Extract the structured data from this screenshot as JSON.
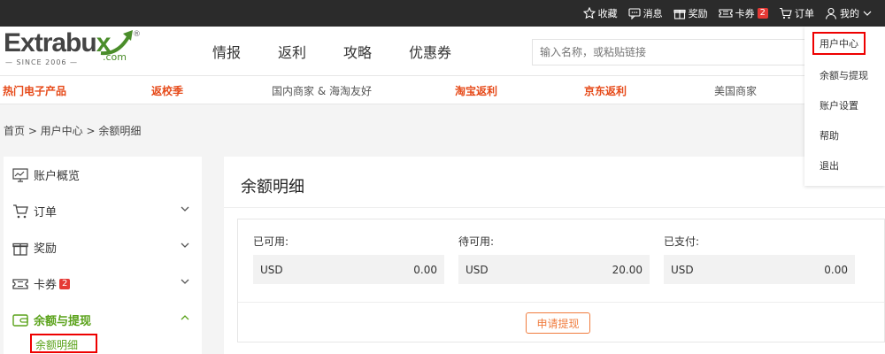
{
  "topbar": {
    "links": [
      {
        "label": "收藏",
        "icon": "star-icon"
      },
      {
        "label": "消息",
        "icon": "message-icon"
      },
      {
        "label": "奖励",
        "icon": "gift-icon"
      },
      {
        "label": "卡券",
        "icon": "coupon-icon",
        "badge": "2"
      },
      {
        "label": "订单",
        "icon": "cart-icon"
      },
      {
        "label": "我的",
        "icon": "user-icon"
      }
    ]
  },
  "logo": {
    "brand_a": "E",
    "brand_b": "xtrabu",
    "brand_c": "x",
    "com": ".com",
    "since": "— SINCE 2006 —",
    "reg": "®"
  },
  "nav": [
    "情报",
    "返利",
    "攻略",
    "优惠券"
  ],
  "search": {
    "placeholder": "输入名称，或粘贴链接"
  },
  "categories": [
    {
      "label": "热门电子产品",
      "style": "hot"
    },
    {
      "label": "返校季",
      "style": "hot"
    },
    {
      "label": "国内商家 & 海淘友好",
      "style": "plain"
    },
    {
      "label": "淘宝返利",
      "style": "hot"
    },
    {
      "label": "京东返利",
      "style": "hot"
    },
    {
      "label": "美国商家",
      "style": "plain"
    }
  ],
  "breadcrumb": "首页 > 用户中心 > 余额明细",
  "sidebar": {
    "items": [
      {
        "label": "账户概览"
      },
      {
        "label": "订单"
      },
      {
        "label": "奖励"
      },
      {
        "label": "卡券",
        "badge": "2"
      },
      {
        "label": "余额与提现"
      }
    ],
    "sub_item": "余额明细"
  },
  "panel": {
    "title": "余额明细",
    "balances": [
      {
        "label": "已可用:",
        "currency": "USD",
        "amount": "0.00"
      },
      {
        "label": "待可用:",
        "currency": "USD",
        "amount": "20.00"
      },
      {
        "label": "已支付:",
        "currency": "USD",
        "amount": "0.00"
      }
    ],
    "withdraw_button": "申请提现"
  },
  "dropdown": [
    "用户中心",
    "余额与提现",
    "账户设置",
    "帮助",
    "退出"
  ],
  "colors": {
    "accent_green": "#5aa21a",
    "hot_orange": "#e64a19",
    "button_orange": "#f07c3e",
    "topbar": "#2b2b2b",
    "highlight_red": "#e00000"
  }
}
